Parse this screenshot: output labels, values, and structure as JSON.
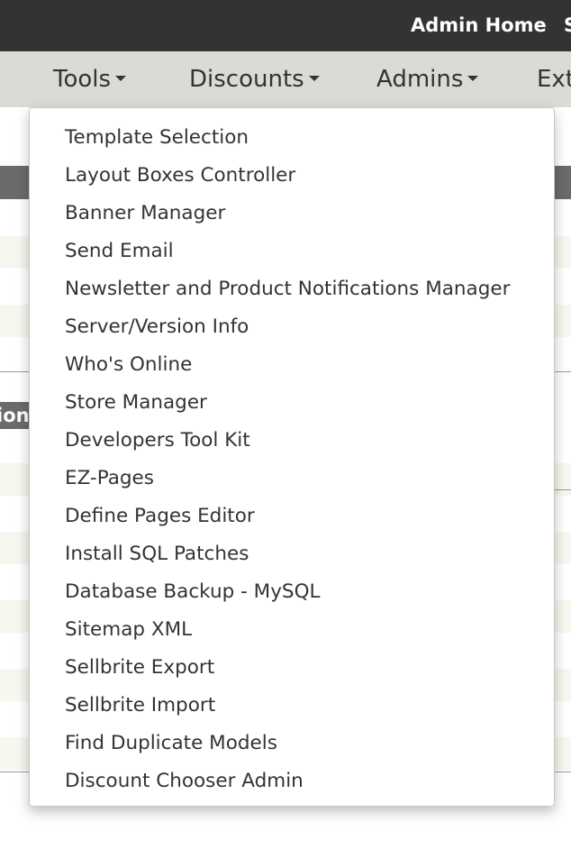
{
  "topbar": {
    "admin_home": "Admin Home",
    "next_cut": "S"
  },
  "nav": {
    "items": [
      {
        "label": "Tools"
      },
      {
        "label": "Discounts"
      },
      {
        "label": "Admins"
      },
      {
        "label": "Ext"
      }
    ]
  },
  "background": {
    "label_cut": "ion"
  },
  "tools_menu": {
    "items": [
      {
        "label": "Template Selection"
      },
      {
        "label": "Layout Boxes Controller"
      },
      {
        "label": "Banner Manager"
      },
      {
        "label": "Send Email"
      },
      {
        "label": "Newsletter and Product Notifications Manager"
      },
      {
        "label": "Server/Version Info"
      },
      {
        "label": "Who's Online"
      },
      {
        "label": "Store Manager"
      },
      {
        "label": "Developers Tool Kit"
      },
      {
        "label": "EZ-Pages"
      },
      {
        "label": "Define Pages Editor"
      },
      {
        "label": "Install SQL Patches"
      },
      {
        "label": "Database Backup - MySQL"
      },
      {
        "label": "Sitemap XML"
      },
      {
        "label": "Sellbrite Export"
      },
      {
        "label": "Sellbrite Import"
      },
      {
        "label": "Find Duplicate Models"
      },
      {
        "label": "Discount Chooser Admin"
      }
    ]
  }
}
